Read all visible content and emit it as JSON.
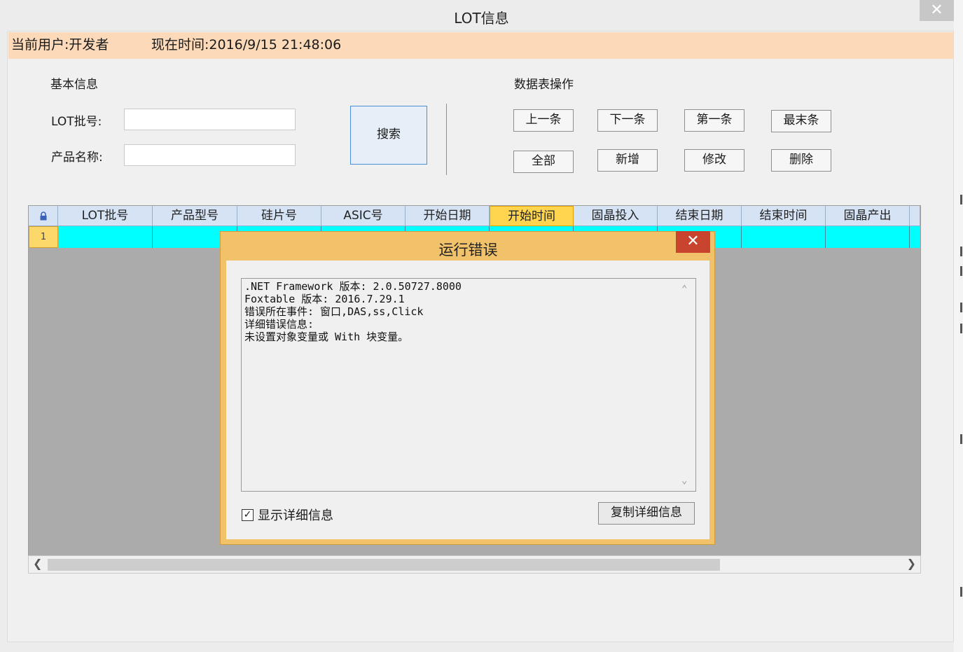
{
  "window": {
    "title": "LOT信息",
    "close_glyph": "✕"
  },
  "status": {
    "user": "当前用户:开发者",
    "time": "现在时间:2016/9/15 21:48:06"
  },
  "basic": {
    "heading": "基本信息",
    "lot_label": "LOT批号:",
    "lot_value": "",
    "product_label": "产品名称:",
    "product_value": "",
    "search_label": "搜索"
  },
  "ops": {
    "heading": "数据表操作",
    "buttons": [
      "上一条",
      "下一条",
      "第一条",
      "最末条",
      "全部",
      "新增",
      "修改",
      "删除"
    ]
  },
  "grid": {
    "lock_icon": "lock-icon",
    "columns": [
      "LOT批号",
      "产品型号",
      "硅片号",
      "ASIC号",
      "开始日期",
      "开始时间",
      "固晶投入",
      "结束日期",
      "结束时间",
      "固晶产出"
    ],
    "selected_column": "开始时间",
    "rows": [
      {
        "row_number": "1",
        "cells": [
          "",
          "",
          "",
          "",
          "",
          "",
          "",
          "",
          "",
          ""
        ]
      }
    ]
  },
  "dialog": {
    "title": "运行错误",
    "close_glyph": "✕",
    "detail_lines": [
      ".NET Framework 版本: 2.0.50727.8000",
      "Foxtable 版本: 2016.7.29.1",
      "错误所在事件: 窗口,DAS,ss,Click",
      "详细错误信息:",
      "未设置对象变量或 With 块变量。"
    ],
    "show_details_label": "显示详细信息",
    "show_details_checked": true,
    "copy_label": "复制详细信息"
  }
}
